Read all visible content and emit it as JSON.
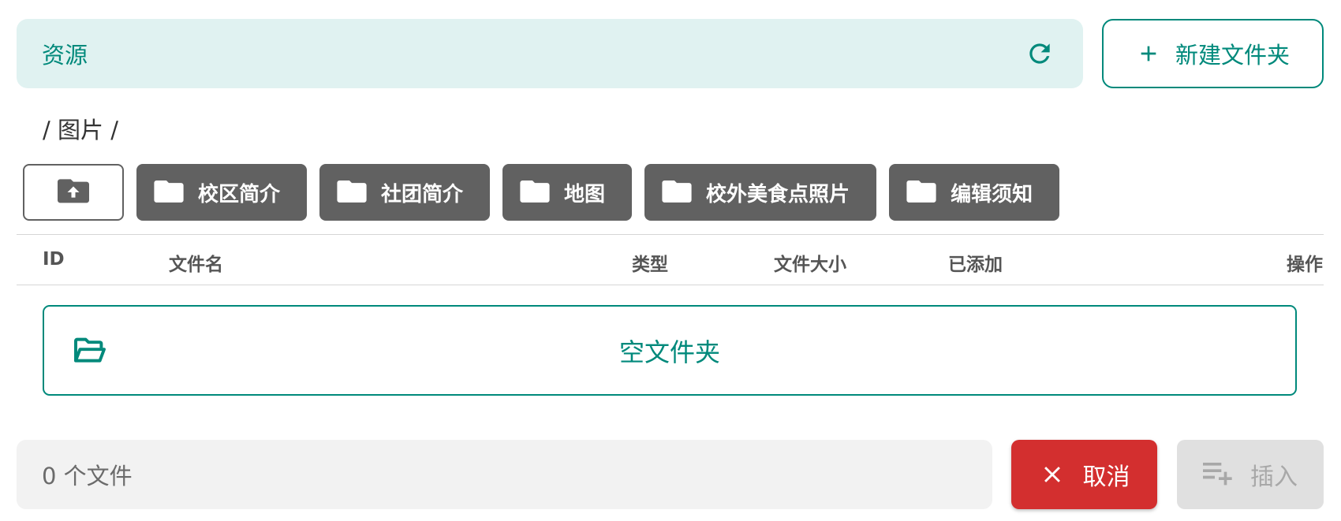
{
  "header": {
    "title": "资源",
    "refresh_icon": "refresh-icon",
    "new_folder_label": "新建文件夹"
  },
  "breadcrumb": {
    "text": "/ 图片 /"
  },
  "folders": [
    {
      "label": "校区简介"
    },
    {
      "label": "社团简介"
    },
    {
      "label": "地图"
    },
    {
      "label": "校外美食点照片"
    },
    {
      "label": "编辑须知"
    }
  ],
  "table": {
    "columns": [
      "ID",
      "文件名",
      "类型",
      "文件大小",
      "已添加",
      "操作"
    ]
  },
  "empty_state": {
    "text": "空文件夹"
  },
  "footer": {
    "file_count": "0 个文件",
    "cancel_label": "取消",
    "insert_label": "插入"
  },
  "colors": {
    "accent": "#00897b",
    "header_bg": "#e0f2f1",
    "folder_bg": "#616161",
    "cancel": "#d32f2f",
    "disabled_bg": "#e0e0e0"
  }
}
